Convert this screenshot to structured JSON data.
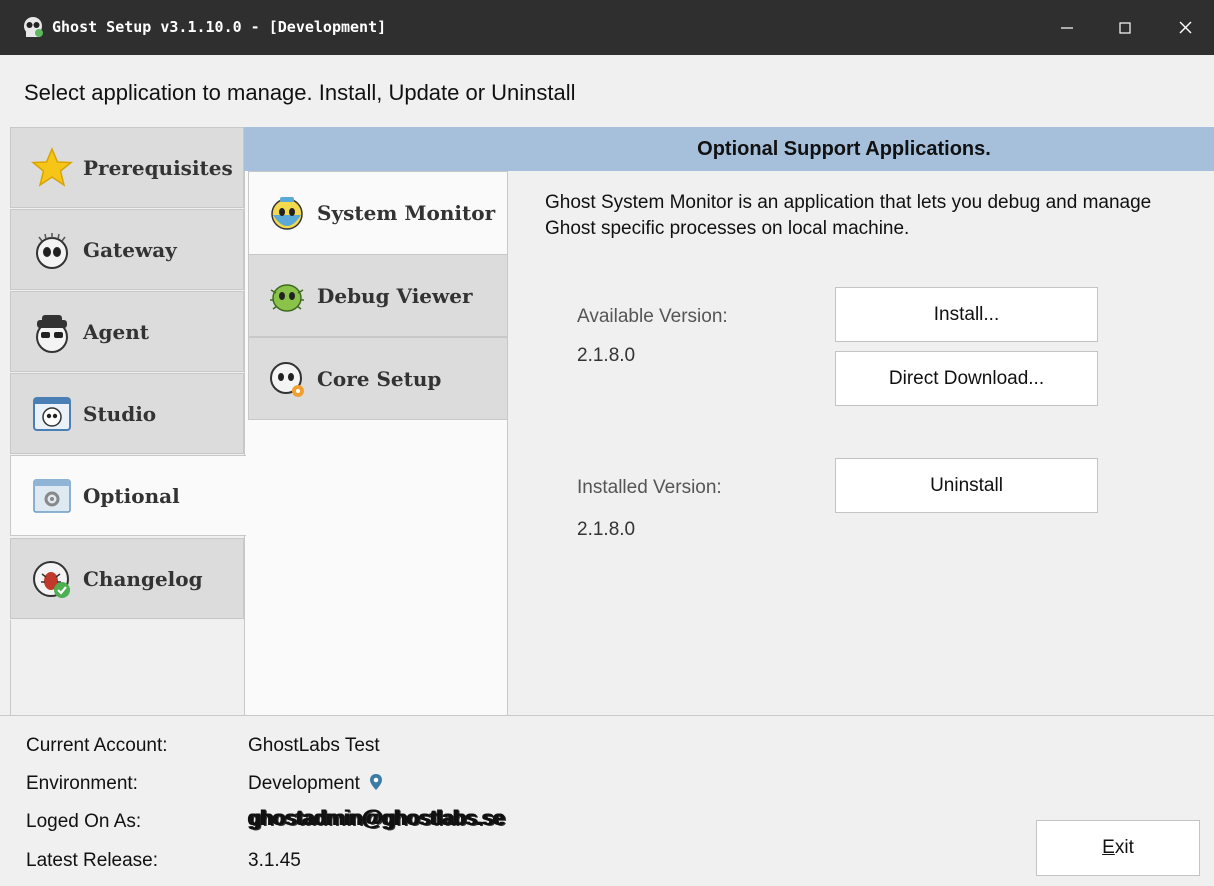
{
  "window": {
    "title": "Ghost Setup v3.1.10.0  - [Development]",
    "minimize_glyph": "—",
    "maximize_glyph": "☐",
    "close_glyph": "✕"
  },
  "header": {
    "text": "Select application to manage. Install, Update or Uninstall"
  },
  "left_tabs": [
    {
      "label": "Prerequisites",
      "icon": "star-icon"
    },
    {
      "label": "Gateway",
      "icon": "ghost-gateway-icon"
    },
    {
      "label": "Agent",
      "icon": "ghost-agent-icon"
    },
    {
      "label": "Studio",
      "icon": "ghost-studio-icon"
    },
    {
      "label": "Optional",
      "icon": "optional-gear-icon",
      "selected": true
    },
    {
      "label": "Changelog",
      "icon": "bug-check-icon"
    }
  ],
  "sub_tabs": [
    {
      "label": "System Monitor",
      "icon": "system-monitor-icon",
      "selected": true
    },
    {
      "label": "Debug Viewer",
      "icon": "debug-viewer-icon"
    },
    {
      "label": "Core Setup",
      "icon": "core-setup-icon"
    }
  ],
  "section": {
    "title": "Optional Support Applications.",
    "description": "Ghost System Monitor is an application that lets you debug and manage Ghost specific processes on local machine.",
    "available_label": "Available Version:",
    "available_value": "2.1.8.0",
    "installed_label": "Installed Version:",
    "installed_value": "2.1.8.0",
    "install_button": "Install...",
    "direct_download_button": "Direct Download...",
    "uninstall_button": "Uninstall"
  },
  "footer": {
    "account_label": "Current Account:",
    "account_value": "GhostLabs Test",
    "environment_label": "Environment:",
    "environment_value": "Development",
    "logon_label": "Loged On As:",
    "logon_value": "ghostadmin@ghostlabs.se",
    "release_label": "Latest Release:",
    "release_value": "3.1.45",
    "exit_button_first": "E",
    "exit_button_rest": "xit"
  },
  "colors": {
    "titlebar": "#2f2f2f",
    "banner": "#a6bfdb",
    "pin": "#3a7ca5"
  }
}
